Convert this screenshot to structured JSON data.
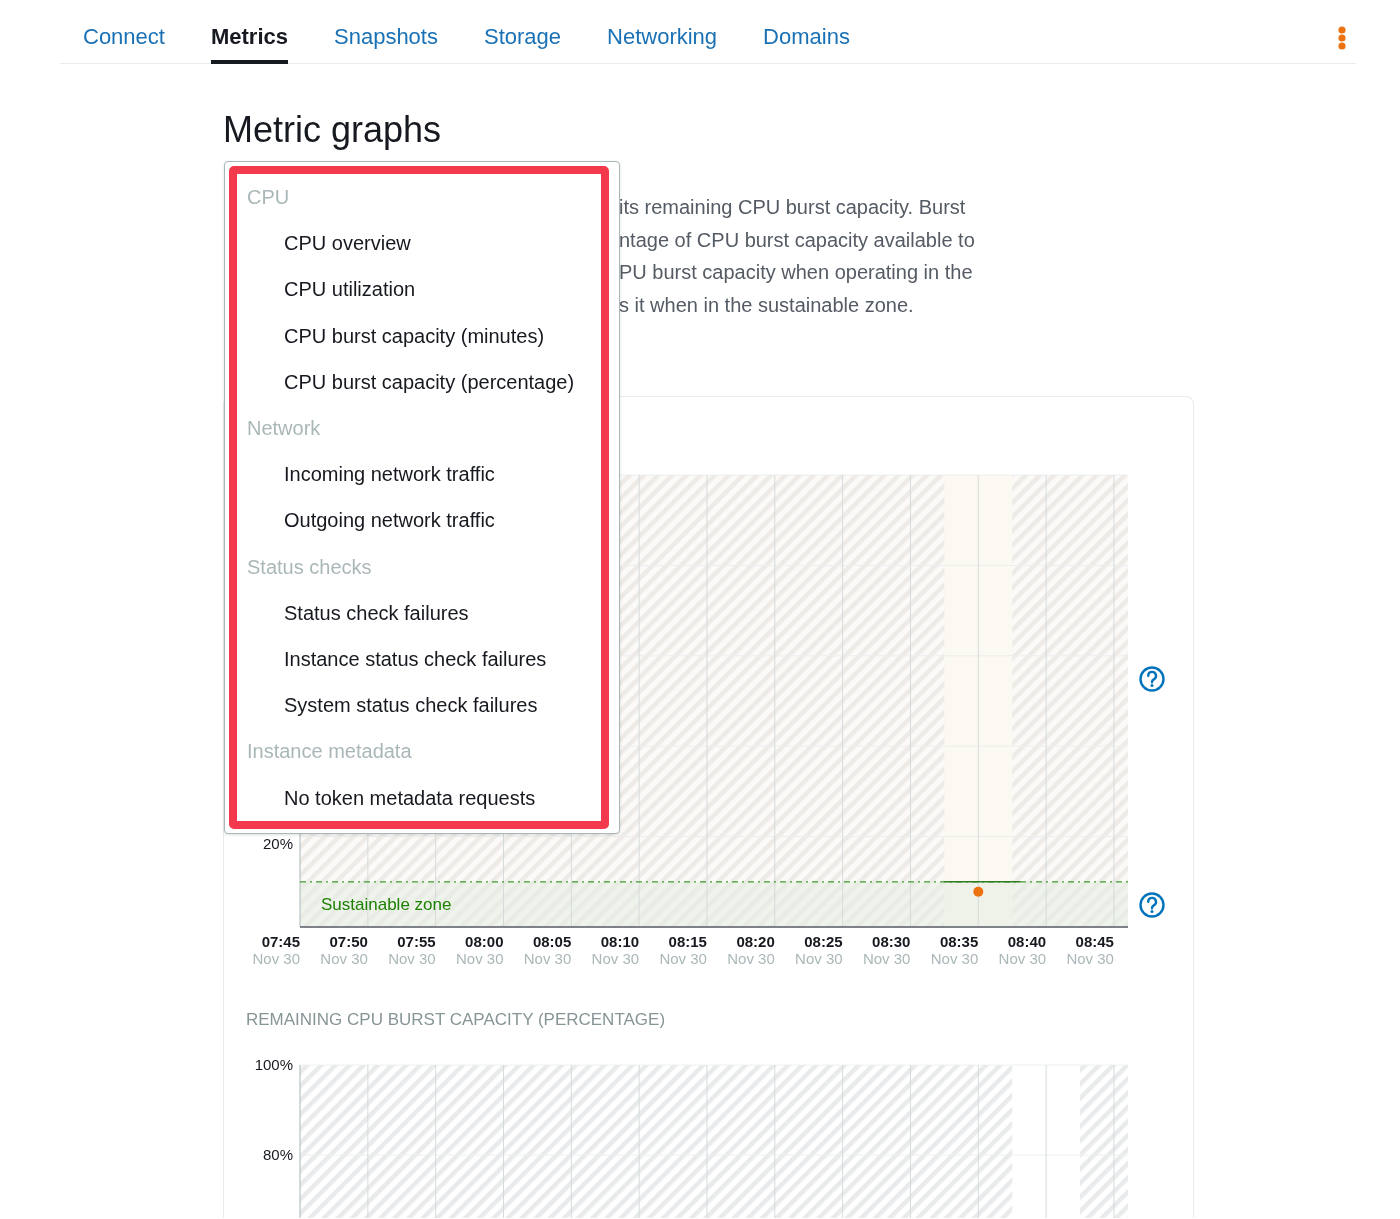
{
  "tabs": [
    {
      "label": "Connect",
      "selected": false
    },
    {
      "label": "Metrics",
      "selected": true
    },
    {
      "label": "Snapshots",
      "selected": false
    },
    {
      "label": "Storage",
      "selected": false
    },
    {
      "label": "Networking",
      "selected": false
    },
    {
      "label": "Domains",
      "selected": false
    }
  ],
  "page_title": "Metric graphs",
  "description_lines": [
    "its remaining CPU burst capacity. Burst",
    "ntage of CPU burst capacity available to",
    "PU burst capacity when operating in the",
    "s it when in the sustainable zone."
  ],
  "metric_menu": {
    "groups": [
      {
        "label": "CPU",
        "options": [
          "CPU overview",
          "CPU utilization",
          "CPU burst capacity (minutes)",
          "CPU burst capacity (percentage)"
        ]
      },
      {
        "label": "Network",
        "options": [
          "Incoming network traffic",
          "Outgoing network traffic"
        ]
      },
      {
        "label": "Status checks",
        "options": [
          "Status check failures",
          "Instance status check failures",
          "System status check failures"
        ]
      },
      {
        "label": "Instance metadata",
        "options": [
          "No token metadata requests"
        ]
      }
    ]
  },
  "cpu_chart": {
    "y_labels": [
      "20%"
    ],
    "zone_label": "Sustainable zone",
    "x_labels": [
      {
        "time": "07:45",
        "date": "Nov 30"
      },
      {
        "time": "07:50",
        "date": "Nov 30"
      },
      {
        "time": "07:55",
        "date": "Nov 30"
      },
      {
        "time": "08:00",
        "date": "Nov 30"
      },
      {
        "time": "08:05",
        "date": "Nov 30"
      },
      {
        "time": "08:10",
        "date": "Nov 30"
      },
      {
        "time": "08:15",
        "date": "Nov 30"
      },
      {
        "time": "08:20",
        "date": "Nov 30"
      },
      {
        "time": "08:25",
        "date": "Nov 30"
      },
      {
        "time": "08:30",
        "date": "Nov 30"
      },
      {
        "time": "08:35",
        "date": "Nov 30"
      },
      {
        "time": "08:40",
        "date": "Nov 30"
      },
      {
        "time": "08:45",
        "date": "Nov 30"
      }
    ]
  },
  "burst_chart": {
    "title": "REMAINING CPU BURST CAPACITY (PERCENTAGE)",
    "y_labels": [
      "100%",
      "80%"
    ]
  }
}
